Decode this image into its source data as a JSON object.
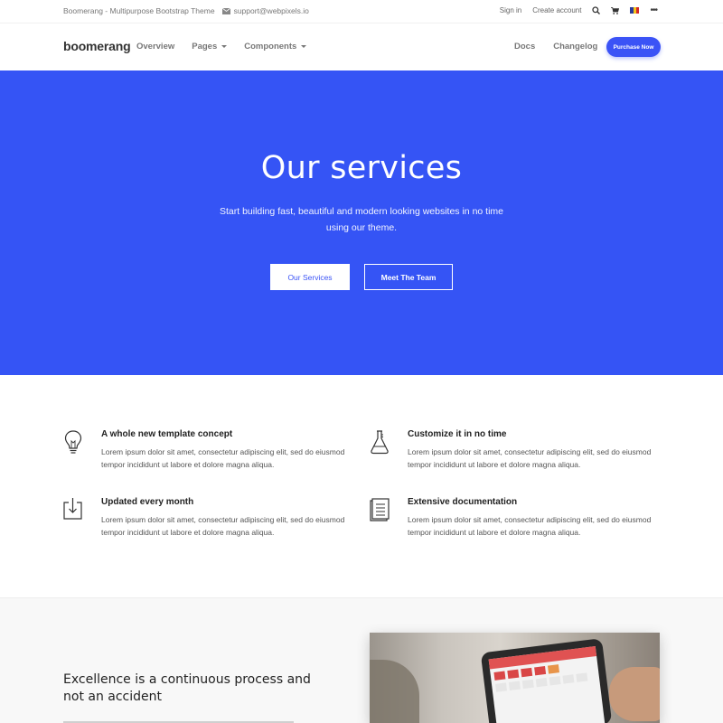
{
  "topbar": {
    "site_title": "Boomerang - Multipurpose Bootstrap Theme",
    "email": "support@webpixels.io",
    "sign_in": "Sign in",
    "create_account": "Create account",
    "icons": [
      "search-icon",
      "cart-icon",
      "flag-icon",
      "more-icon"
    ],
    "more": "•••"
  },
  "navbar": {
    "logo": "boomerang",
    "items": [
      {
        "label": "Overview",
        "dropdown": false
      },
      {
        "label": "Pages",
        "dropdown": true
      },
      {
        "label": "Components",
        "dropdown": true
      }
    ],
    "docs": "Docs",
    "changelog": "Changelog",
    "purchase": "Purchase Now"
  },
  "hero": {
    "title": "Our services",
    "subtitle": "Start building fast, beautiful and modern looking websites in no time using our theme.",
    "primary_button": "Our Services",
    "secondary_button": "Meet The Team",
    "background": "#3554f5"
  },
  "features": [
    {
      "icon": "lightbulb-icon",
      "title": "A whole new template concept",
      "text": "Lorem ipsum dolor sit amet, consectetur adipiscing elit, sed do eiusmod tempor incididunt ut labore et dolore magna aliqua."
    },
    {
      "icon": "flask-icon",
      "title": "Customize it in no time",
      "text": "Lorem ipsum dolor sit amet, consectetur adipiscing elit, sed do eiusmod tempor incididunt ut labore et dolore magna aliqua."
    },
    {
      "icon": "download-icon",
      "title": "Updated every month",
      "text": "Lorem ipsum dolor sit amet, consectetur adipiscing elit, sed do eiusmod tempor incididunt ut labore et dolore magna aliqua."
    },
    {
      "icon": "document-icon",
      "title": "Extensive documentation",
      "text": "Lorem ipsum dolor sit amet, consectetur adipiscing elit, sed do eiusmod tempor incididunt ut labore et dolore magna aliqua."
    }
  ],
  "excellence": {
    "title": "Excellence is a continuous process and not an accident"
  },
  "colors": {
    "accent": "#3b53f6",
    "flag": [
      "#2b3b97",
      "#f5c518",
      "#d42a2a"
    ]
  }
}
